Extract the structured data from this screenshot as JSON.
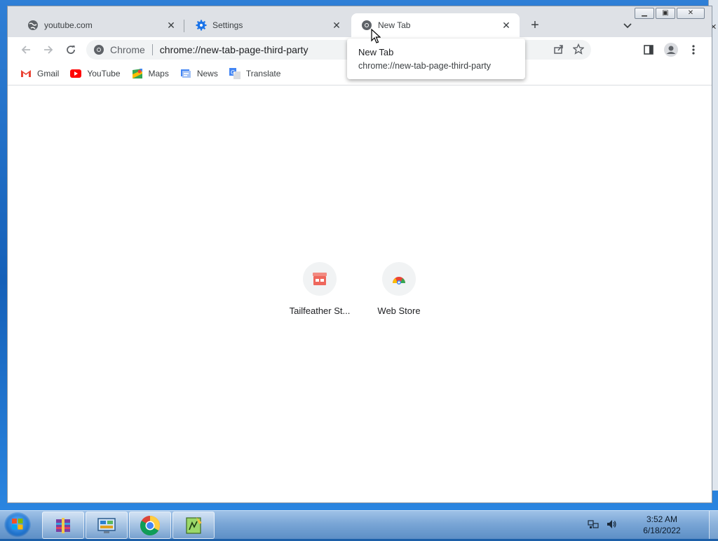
{
  "tabs": [
    {
      "title": "youtube.com",
      "icon": "globe-icon",
      "close": "✕"
    },
    {
      "title": "Settings",
      "icon": "gear-icon",
      "close": "✕"
    },
    {
      "title": "New Tab",
      "icon": "chrome-icon",
      "close": "✕"
    }
  ],
  "tabstrip": {
    "new_tab": "+",
    "tab_search": "⌄"
  },
  "omnibox": {
    "origin": "Chrome",
    "url": "chrome://new-tab-page-third-party"
  },
  "bookmarks": [
    {
      "label": "Gmail",
      "icon": "gmail-icon",
      "color": "#ea4335"
    },
    {
      "label": "YouTube",
      "icon": "youtube-icon",
      "color": "#ff0000"
    },
    {
      "label": "Maps",
      "icon": "maps-icon",
      "color": "#34a853"
    },
    {
      "label": "News",
      "icon": "news-icon",
      "color": "#4285f4"
    },
    {
      "label": "Translate",
      "icon": "translate-icon",
      "color": "#4285f4"
    }
  ],
  "shortcuts": [
    {
      "label": "Tailfeather St...",
      "icon": "store-icon"
    },
    {
      "label": "Web Store",
      "icon": "webstore-icon"
    }
  ],
  "tooltip": {
    "title": "New Tab",
    "url": "chrome://new-tab-page-third-party"
  },
  "taskbar": {
    "apps": [
      "winrar-icon",
      "control-panel-icon",
      "chrome-icon",
      "notepad-icon"
    ],
    "clock": {
      "time": "3:52 AM",
      "date": "6/18/2022"
    }
  },
  "colors": {
    "accent": "#1a73e8",
    "tab_bg": "#dee1e6"
  }
}
